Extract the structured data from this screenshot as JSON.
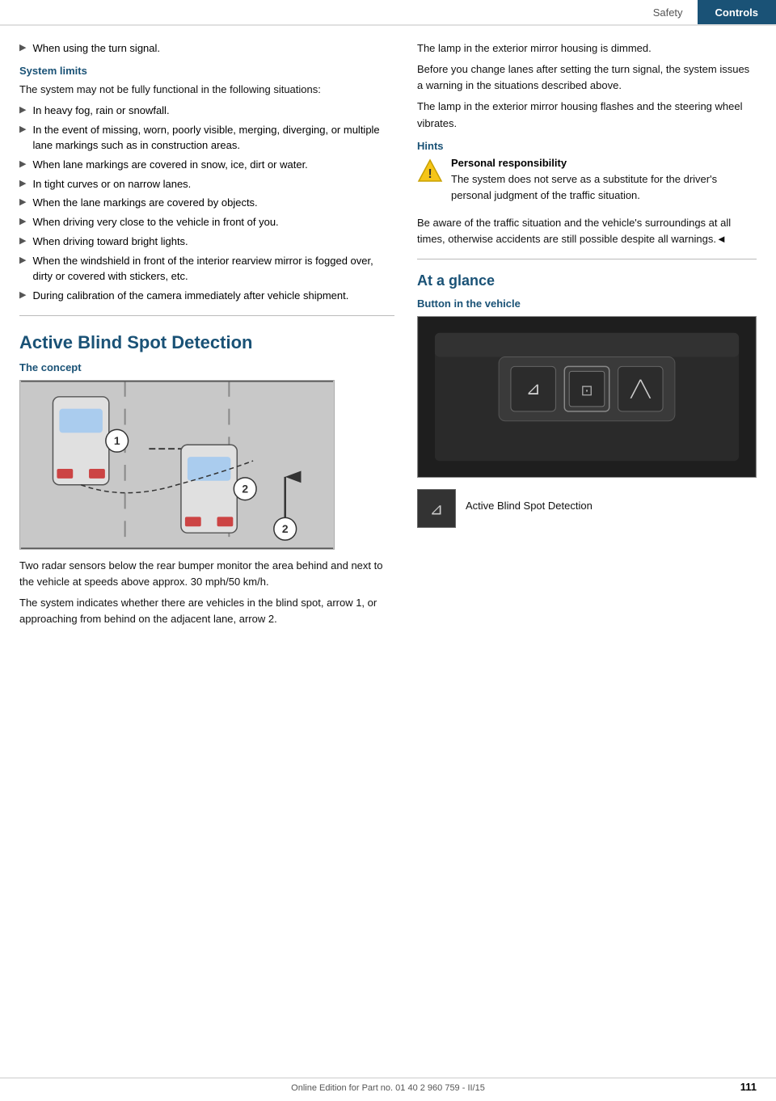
{
  "header": {
    "safety_label": "Safety",
    "controls_label": "Controls"
  },
  "left_col": {
    "intro_bullet": "When using the turn signal.",
    "system_limits": {
      "heading": "System limits",
      "intro": "The system may not be fully functional in the following situations:",
      "bullets": [
        "In heavy fog, rain or snowfall.",
        "In the event of missing, worn, poorly visible, merging, diverging, or multiple lane markings such as in construction areas.",
        "When lane markings are covered in snow, ice, dirt or water.",
        "In tight curves or on narrow lanes.",
        "When the lane markings are covered by objects.",
        "When driving very close to the vehicle in front of you.",
        "When driving toward bright lights.",
        "When the windshield in front of the interior rearview mirror is fogged over, dirty or covered with stickers, etc.",
        "During calibration of the camera immediately after vehicle shipment."
      ]
    },
    "active_blind_spot": {
      "heading": "Active Blind Spot Detection",
      "concept_heading": "The concept",
      "concept_desc1": "Two radar sensors below the rear bumper monitor the area behind and next to the vehicle at speeds above approx. 30 mph/50 km/h.",
      "concept_desc2": "The system indicates whether there are vehicles in the blind spot, arrow 1, or approaching from behind on the adjacent lane, arrow 2."
    }
  },
  "right_col": {
    "para1": "The lamp in the exterior mirror housing is dimmed.",
    "para2": "Before you change lanes after setting the turn signal, the system issues a warning in the situations described above.",
    "para3": "The lamp in the exterior mirror housing flashes and the steering wheel vibrates.",
    "hints": {
      "heading": "Hints",
      "warning_title": "Personal responsibility",
      "warning_text": "The system does not serve as a substitute for the driver's personal judgment of the traffic situation.",
      "awareness_text": "Be aware of the traffic situation and the vehicle's surroundings at all times, otherwise accidents are still possible despite all warnings.◄"
    },
    "at_a_glance": {
      "heading": "At a glance",
      "button_in_vehicle": "Button in the vehicle",
      "icon_label": "Active Blind Spot Detection"
    }
  },
  "footer": {
    "text": "Online Edition for Part no. 01 40 2 960 759 - II/15",
    "page_number": "111"
  }
}
